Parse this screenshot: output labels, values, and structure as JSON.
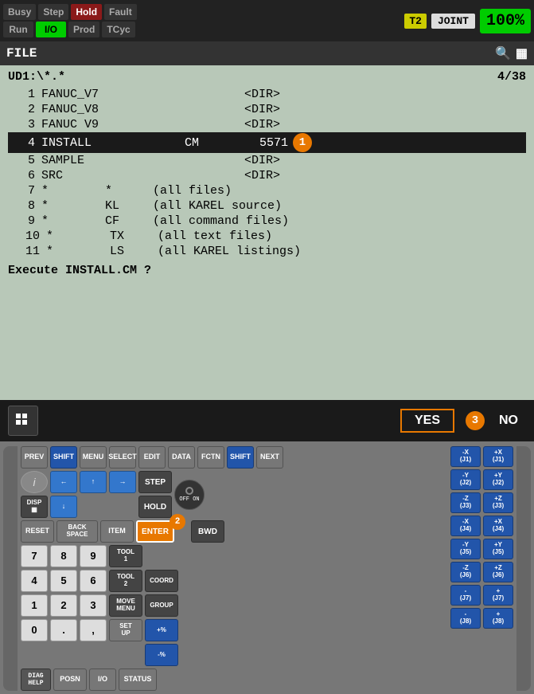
{
  "statusBar": {
    "buttons": [
      {
        "label": "Busy",
        "style": "dark"
      },
      {
        "label": "Step",
        "style": "dark"
      },
      {
        "label": "Hold",
        "style": "red"
      },
      {
        "label": "Fault",
        "style": "dark"
      },
      {
        "label": "Run",
        "style": "dark"
      },
      {
        "label": "I/O",
        "style": "green-bright"
      },
      {
        "label": "Prod",
        "style": "dark"
      },
      {
        "label": "TCyc",
        "style": "dark"
      }
    ],
    "t2": "T2",
    "joint": "JOINT",
    "percent": "100",
    "percentSymbol": "%"
  },
  "fileBar": {
    "title": "FILE"
  },
  "fileListing": {
    "path": "UD1:\\*.*",
    "count": "4/38",
    "items": [
      {
        "num": "1",
        "name": "FANUC_V7",
        "ext": "",
        "size": "<DIR>",
        "selected": false
      },
      {
        "num": "2",
        "name": "FANUC_V8",
        "ext": "",
        "size": "<DIR>",
        "selected": false
      },
      {
        "num": "3",
        "name": "FANUC V9",
        "ext": "",
        "size": "<DIR>",
        "selected": false
      },
      {
        "num": "4",
        "name": "INSTALL",
        "ext": "CM",
        "size": "5571",
        "selected": true
      },
      {
        "num": "5",
        "name": "SAMPLE",
        "ext": "",
        "size": "<DIR>",
        "selected": false
      },
      {
        "num": "6",
        "name": "SRC",
        "ext": "",
        "size": "<DIR>",
        "selected": false
      },
      {
        "num": "7",
        "name": "*",
        "ext": "*",
        "size": "(all files)",
        "selected": false
      },
      {
        "num": "8",
        "name": "*",
        "ext": "KL",
        "size": "(all KAREL source)",
        "selected": false
      },
      {
        "num": "9",
        "name": "*",
        "ext": "CF",
        "size": "(all command files)",
        "selected": false
      },
      {
        "num": "10",
        "name": "*",
        "ext": "TX",
        "size": "(all text files)",
        "selected": false
      },
      {
        "num": "11",
        "name": "*",
        "ext": "LS",
        "size": "(all KAREL listings)",
        "selected": false
      }
    ],
    "executePrompt": "Execute INSTALL.CM ?"
  },
  "bottomBar": {
    "yesLabel": "YES",
    "noLabel": "NO",
    "badge3": "3"
  },
  "keyboard": {
    "row1": [
      "PREV",
      "SHIFT",
      "MENU",
      "SELECT",
      "EDIT",
      "DATA",
      "FCTN",
      "SHIFT",
      "NEXT"
    ],
    "infoBtn": "i",
    "leftArrow": "←",
    "upArrow": "↑",
    "downArrow": "↓",
    "rightArrow": "→",
    "dispLabel": "DISP",
    "offOnLabel": "OFF ON",
    "resetLabel": "RESET",
    "backspaceLabel": "BACK SPACE",
    "itemLabel": "ITEM",
    "enterLabel": "ENTER",
    "badge2": "2",
    "stepLabel": "STEP",
    "holdLabel": "HOLD",
    "bwdLabel": "BWD",
    "tool1Label": "TOOL 1",
    "tool2Label": "TOOL 2",
    "coordLabel": "COORD",
    "moveMenuLabel": "MOVE MENU",
    "groupLabel": "GROUP",
    "setupLabel": "SET UP",
    "plusPctLabel": "+%",
    "minusPctLabel": "-%",
    "diagHelpLabel": "DIAG HELP",
    "posnLabel": "POSN",
    "ioLabel": "I/O",
    "statusLabel": "STATUS",
    "numKeys": [
      "7",
      "8",
      "9",
      "4",
      "5",
      "6",
      "1",
      "2",
      "3",
      "0",
      ".",
      ","
    ],
    "axisKeys": [
      [
        "-X\n(J1)",
        "+X\n(J1)"
      ],
      [
        "-Y\n(J2)",
        "+Y\n(J2)"
      ],
      [
        "-Z\n(J3)",
        "+Z\n(J3)"
      ],
      [
        "-X\n(J4)",
        "+X\n(J4)"
      ],
      [
        "-Y\n(J5)",
        "+Y\n(J5)"
      ],
      [
        "-Z\n(J6)",
        "+Z\n(J6)"
      ],
      [
        "-\n(J7)",
        "+\n(J7)"
      ],
      [
        "-\n(J8)",
        "+\n(J8)"
      ]
    ]
  }
}
